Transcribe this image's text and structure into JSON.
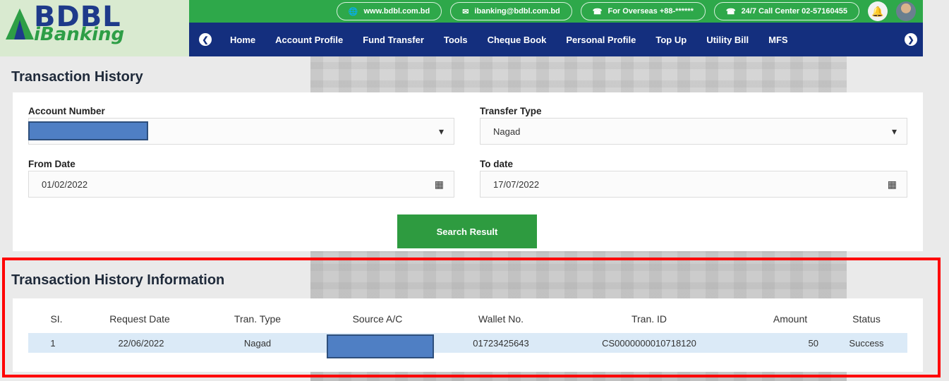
{
  "brand": {
    "name_line1": "BDBL",
    "name_line2": "iBanking"
  },
  "topbar": {
    "website": "www.bdbl.com.bd",
    "email": "ibanking@bdbl.com.bd",
    "overseas": "For Overseas +88-******",
    "call_center": "24/7 Call Center 02-57160455",
    "colors": {
      "bg": "#2ea84a"
    }
  },
  "nav": {
    "items": [
      "Home",
      "Account Profile",
      "Fund Transfer",
      "Tools",
      "Cheque Book",
      "Personal Profile",
      "Top Up",
      "Utility Bill",
      "MFS"
    ],
    "colors": {
      "bg": "#142f7e"
    }
  },
  "page": {
    "title": "Transaction History"
  },
  "form": {
    "account_number_label": "Account Number",
    "transfer_type_label": "Transfer Type",
    "transfer_type_value": "Nagad",
    "from_date_label": "From Date",
    "from_date_value": "01/02/2022",
    "to_date_label": "To date",
    "to_date_value": "17/07/2022",
    "search_button": "Search Result"
  },
  "results": {
    "title": "Transaction History Information",
    "columns": [
      "SI.",
      "Request Date",
      "Tran. Type",
      "Source A/C",
      "Wallet No.",
      "Tran. ID",
      "Amount",
      "Status"
    ],
    "rows": [
      {
        "si": "1",
        "request_date": "22/06/2022",
        "tran_type": "Nagad",
        "source_ac": "",
        "wallet_no": "01723425643",
        "tran_id": "CS0000000010718120",
        "amount": "50",
        "status": "Success"
      }
    ]
  }
}
